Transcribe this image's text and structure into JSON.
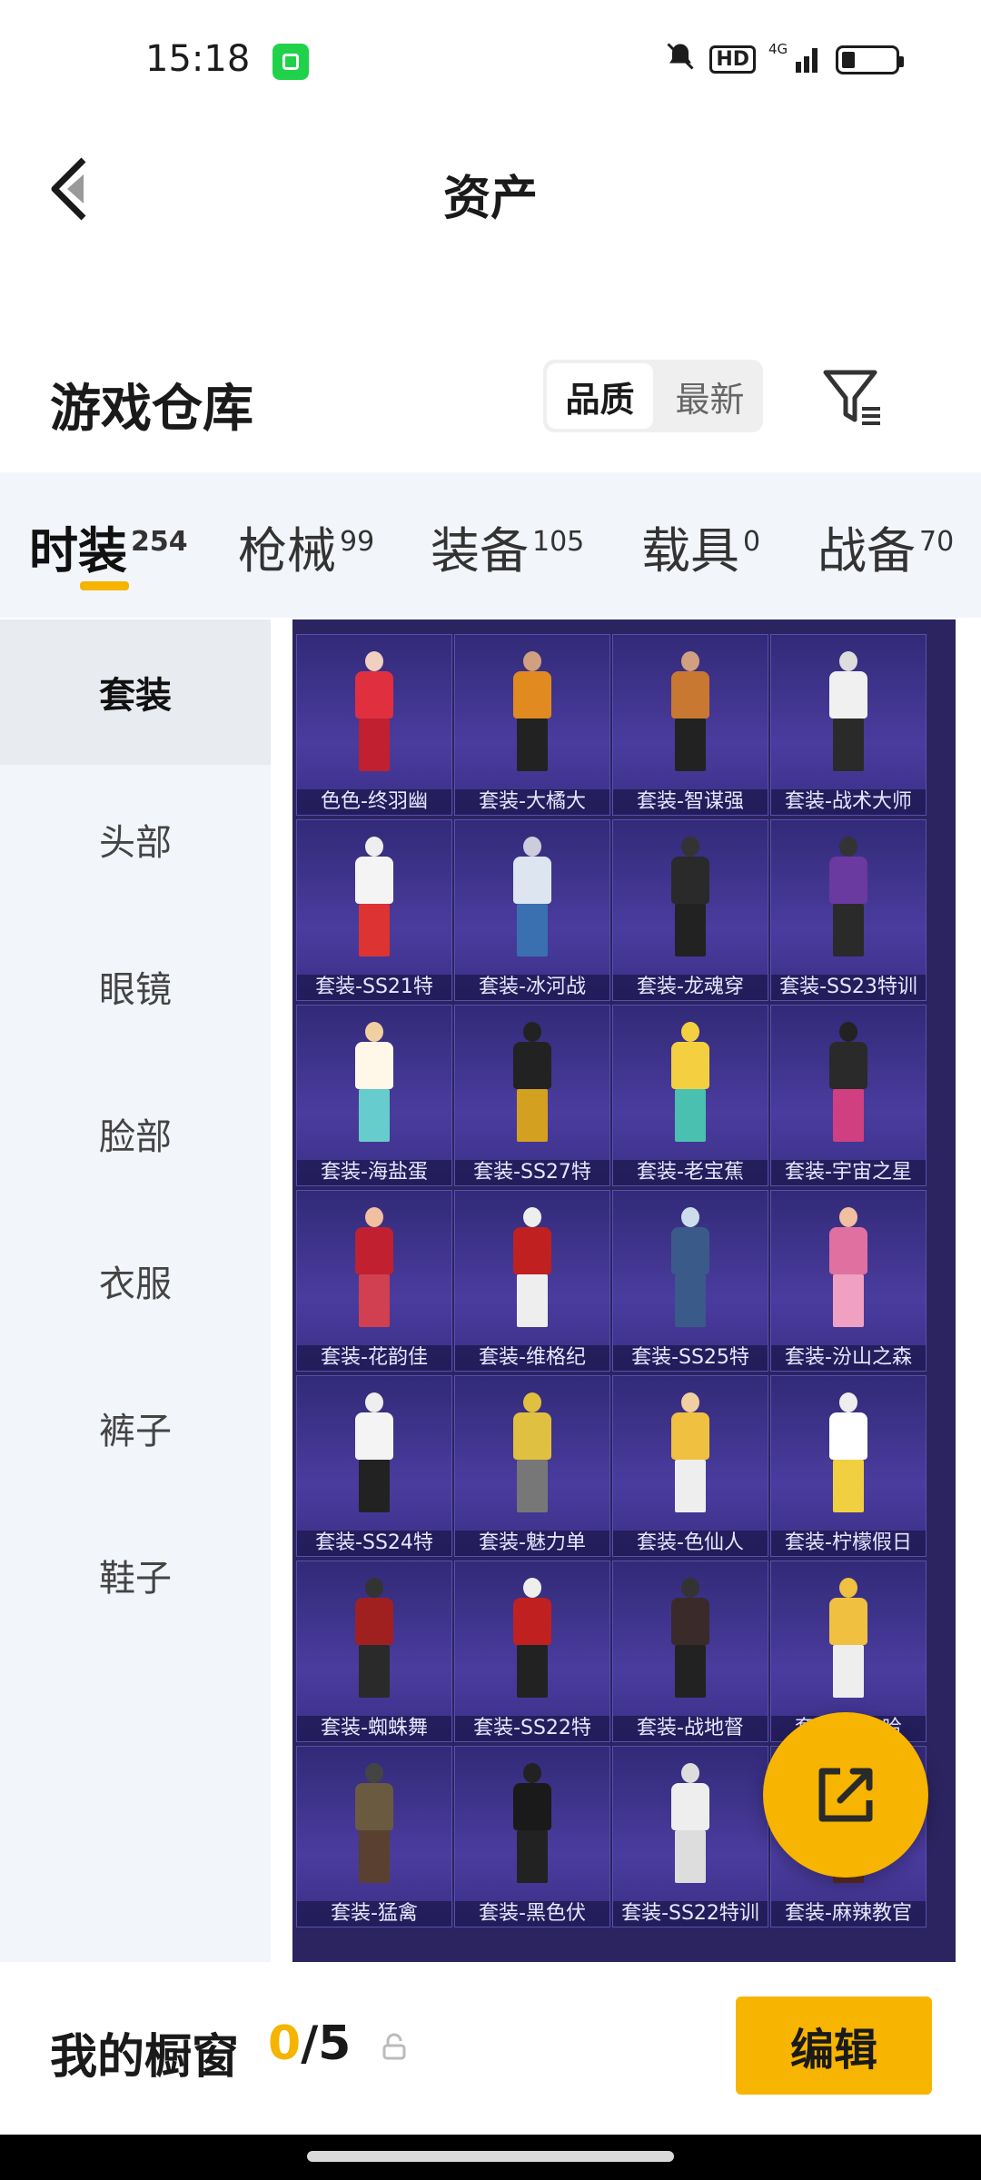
{
  "status_bar": {
    "time": "15:18",
    "network": "4G"
  },
  "header": {
    "title": "资产"
  },
  "warehouse": {
    "title": "游戏仓库",
    "sort_options": [
      "品质",
      "最新"
    ],
    "active_sort": "品质"
  },
  "tabs": [
    {
      "label": "时装",
      "count": "254",
      "active": true
    },
    {
      "label": "枪械",
      "count": "99"
    },
    {
      "label": "装备",
      "count": "105"
    },
    {
      "label": "载具",
      "count": "0"
    },
    {
      "label": "战备",
      "count": "70"
    }
  ],
  "sidebar": {
    "items": [
      {
        "label": "套装",
        "active": true
      },
      {
        "label": "头部"
      },
      {
        "label": "眼镜"
      },
      {
        "label": "脸部"
      },
      {
        "label": "衣服"
      },
      {
        "label": "裤子"
      },
      {
        "label": "鞋子"
      }
    ]
  },
  "grid": {
    "items": [
      {
        "label": "色色-终羽幽"
      },
      {
        "label": "套装-大橘大"
      },
      {
        "label": "套装-智谋强"
      },
      {
        "label": "套装-战术大师"
      },
      {
        "label": "套装-SS21特"
      },
      {
        "label": "套装-冰河战"
      },
      {
        "label": "套装-龙魂穿"
      },
      {
        "label": "套装-SS23特训"
      },
      {
        "label": "套装-海盐蛋"
      },
      {
        "label": "套装-SS27特"
      },
      {
        "label": "套装-老宝蕉"
      },
      {
        "label": "套装-宇宙之星"
      },
      {
        "label": "套装-花韵佳"
      },
      {
        "label": "套装-维格纪"
      },
      {
        "label": "套装-SS25特"
      },
      {
        "label": "套装-汾山之森"
      },
      {
        "label": "套装-SS24特"
      },
      {
        "label": "套装-魅力单"
      },
      {
        "label": "套装-色仙人"
      },
      {
        "label": "套装-柠檬假日"
      },
      {
        "label": "套装-蜘蛛舞"
      },
      {
        "label": "套装-SS22特"
      },
      {
        "label": "套装-战地督"
      },
      {
        "label": "套装-黄金哈"
      },
      {
        "label": "套装-猛禽"
      },
      {
        "label": "套装-黑色伏"
      },
      {
        "label": "套装-SS22特训"
      },
      {
        "label": "套装-麻辣教官"
      }
    ]
  },
  "bottom_bar": {
    "title": "我的橱窗",
    "current": "0",
    "total": "/5",
    "edit_label": "编辑"
  },
  "colors": {
    "accent": "#f5b400",
    "grid_bg": "#3a2f86"
  }
}
